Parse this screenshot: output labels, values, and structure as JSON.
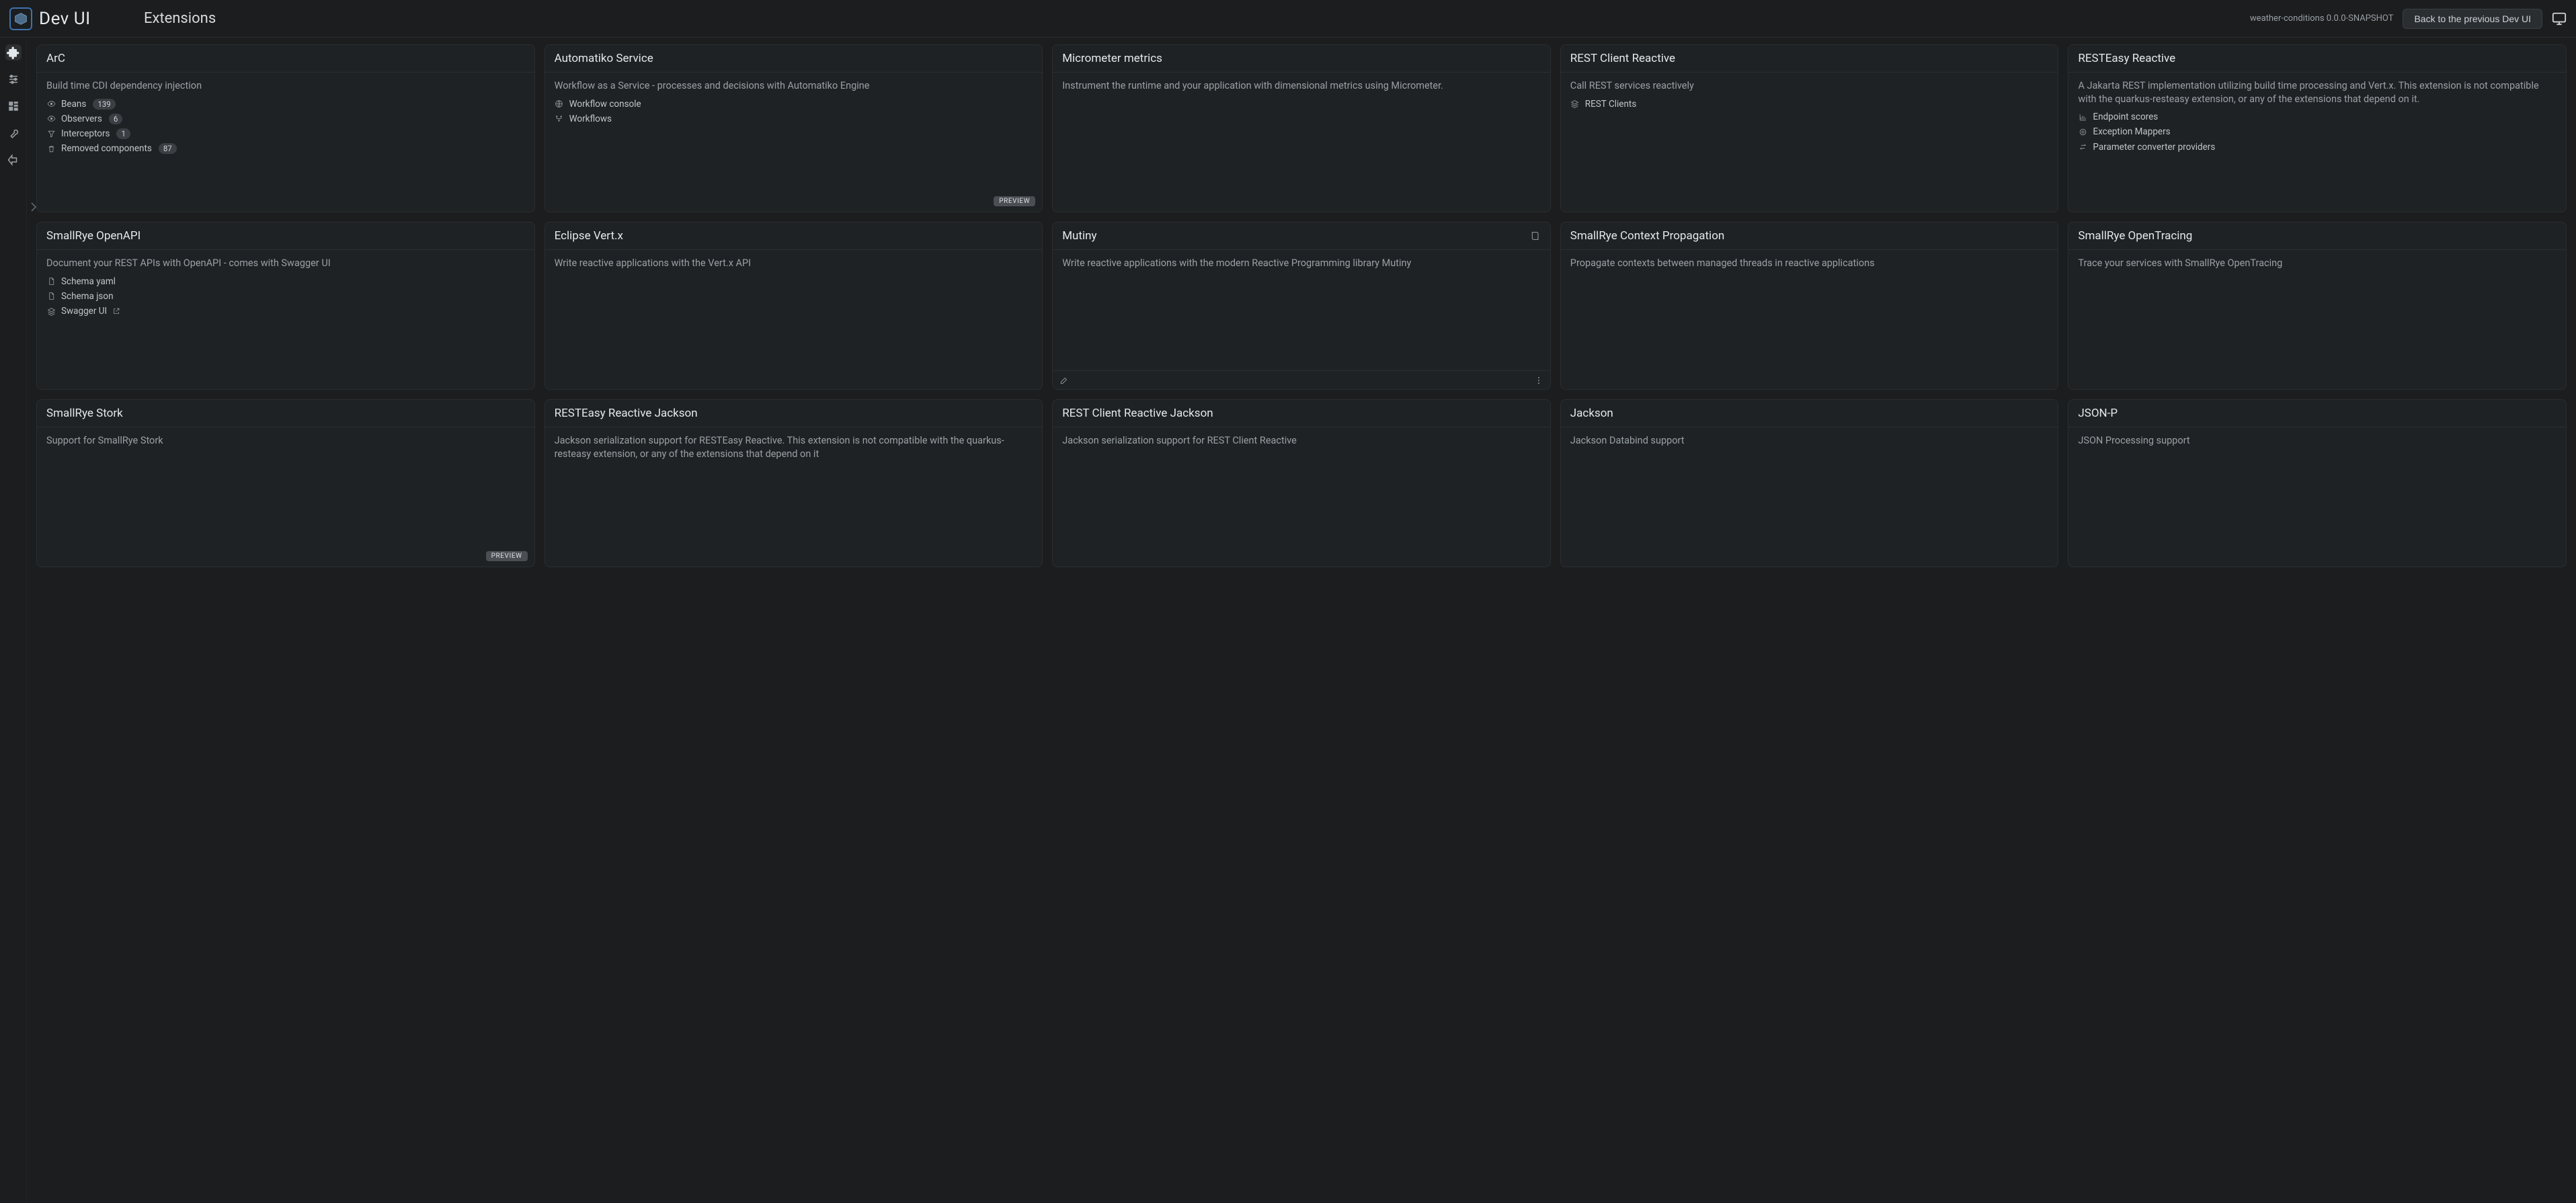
{
  "header": {
    "brand": "Dev UI",
    "page_title": "Extensions",
    "meta": "weather-conditions 0.0.0-SNAPSHOT",
    "back_label": "Back to the previous Dev UI"
  },
  "sidebar": {
    "items": [
      {
        "name": "extensions",
        "label": "Extensions"
      },
      {
        "name": "config",
        "label": "Configuration"
      },
      {
        "name": "build",
        "label": "Build"
      },
      {
        "name": "tools",
        "label": "Tools"
      },
      {
        "name": "endpoints",
        "label": "Endpoints"
      }
    ]
  },
  "cards": [
    {
      "title": "ArC",
      "desc": "Build time CDI dependency injection",
      "links": [
        {
          "icon": "eye-icon",
          "label": "Beans",
          "count": "139"
        },
        {
          "icon": "eye-icon",
          "label": "Observers",
          "count": "6"
        },
        {
          "icon": "filter-icon",
          "label": "Interceptors",
          "count": "1"
        },
        {
          "icon": "trash-icon",
          "label": "Removed components",
          "count": "87"
        }
      ]
    },
    {
      "title": "Automatiko Service",
      "desc": "Workflow as a Service - processes and decisions with Automatiko Engine",
      "preview": "PREVIEW",
      "links": [
        {
          "icon": "globe-icon",
          "label": "Workflow console"
        },
        {
          "icon": "flow-icon",
          "label": "Workflows"
        }
      ]
    },
    {
      "title": "Micrometer metrics",
      "desc": "Instrument the runtime and your application with dimensional metrics using Micrometer."
    },
    {
      "title": "REST Client Reactive",
      "desc": "Call REST services reactively",
      "links": [
        {
          "icon": "layers-icon",
          "label": "REST Clients"
        }
      ]
    },
    {
      "title": "RESTEasy Reactive",
      "desc": "A Jakarta REST implementation utilizing build time processing and Vert.x. This extension is not compatible with the quarkus-resteasy extension, or any of the extensions that depend on it.",
      "links": [
        {
          "icon": "chart-icon",
          "label": "Endpoint scores"
        },
        {
          "icon": "target-icon",
          "label": "Exception Mappers"
        },
        {
          "icon": "swap-icon",
          "label": "Parameter converter providers"
        }
      ]
    },
    {
      "title": "SmallRye OpenAPI",
      "desc": "Document your REST APIs with OpenAPI - comes with Swagger UI",
      "links": [
        {
          "icon": "file-icon",
          "label": "Schema yaml"
        },
        {
          "icon": "file-icon",
          "label": "Schema json"
        },
        {
          "icon": "layers-icon",
          "label": "Swagger UI",
          "external": true
        }
      ]
    },
    {
      "title": "Eclipse Vert.x",
      "desc": "Write reactive applications with the Vert.x API"
    },
    {
      "title": "Mutiny",
      "header_icon": "book-icon",
      "desc": "Write reactive applications with the modern Reactive Programming library Mutiny",
      "footer": {
        "left_icon": "edit-icon",
        "right_icon": "kebab-icon"
      }
    },
    {
      "title": "SmallRye Context Propagation",
      "desc": "Propagate contexts between managed threads in reactive applications"
    },
    {
      "title": "SmallRye OpenTracing",
      "desc": "Trace your services with SmallRye OpenTracing"
    },
    {
      "title": "SmallRye Stork",
      "desc": "Support for SmallRye Stork",
      "preview": "PREVIEW"
    },
    {
      "title": "RESTEasy Reactive Jackson",
      "desc": "Jackson serialization support for RESTEasy Reactive. This extension is not compatible with the quarkus-resteasy extension, or any of the extensions that depend on it"
    },
    {
      "title": "REST Client Reactive Jackson",
      "desc": "Jackson serialization support for REST Client Reactive"
    },
    {
      "title": "Jackson",
      "desc": "Jackson Databind support"
    },
    {
      "title": "JSON-P",
      "desc": "JSON Processing support"
    }
  ]
}
